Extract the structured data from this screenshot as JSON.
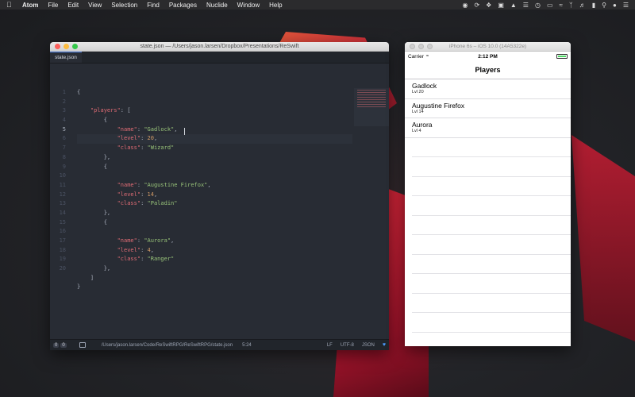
{
  "menubar": {
    "app": "Atom",
    "items": [
      "File",
      "Edit",
      "View",
      "Selection",
      "Find",
      "Packages",
      "Nuclide",
      "Window",
      "Help"
    ]
  },
  "atom": {
    "title": "state.json — /Users/jason.larsen/Dropbox/Presentations/ReSwift",
    "tab": "state.json",
    "line_numbers": [
      "1",
      "2",
      "3",
      "4",
      "5",
      "6",
      "7",
      "8",
      "9",
      "10",
      "11",
      "12",
      "13",
      "14",
      "15",
      "16",
      "17",
      "18",
      "19",
      "20"
    ],
    "status": {
      "count_a": "0",
      "count_b": "0",
      "path": "/Users/jason.larsen/Code/ReSwiftRPG/ReSwiftRPG/state.json",
      "position": "5:24",
      "line_ending": "LF",
      "encoding": "UTF-8",
      "grammar": "JSON"
    }
  },
  "code": {
    "open_brace": "{",
    "players_key": "\"players\"",
    "colon_bracket": ": [",
    "obj_open": "{",
    "obj_close": "},",
    "obj_close_last": "},",
    "arr_close": "]",
    "close_brace": "}",
    "k_name": "\"name\"",
    "k_level": "\"level\"",
    "k_class": "\"class\"",
    "players": [
      {
        "name": "\"Gadlock\"",
        "level": "20",
        "class": "\"Wizard\""
      },
      {
        "name": "\"Augustine Firefox\"",
        "level": "14",
        "class": "\"Paladin\""
      },
      {
        "name": "\"Aurora\"",
        "level": "4",
        "class": "\"Ranger\""
      }
    ]
  },
  "simulator": {
    "title": "iPhone 6s – iOS 10.0 (14A5322e)",
    "carrier": "Carrier",
    "time": "2:12 PM",
    "nav_title": "Players",
    "rows": [
      {
        "name": "Gadlock",
        "level": "Lvl 20"
      },
      {
        "name": "Augustine Firefox",
        "level": "Lvl 14"
      },
      {
        "name": "Aurora",
        "level": "Lvl 4"
      }
    ]
  },
  "colors": {
    "atom_bg": "#282c34",
    "json_key": "#e06c75",
    "json_string": "#98c379",
    "json_number": "#d19a66"
  }
}
